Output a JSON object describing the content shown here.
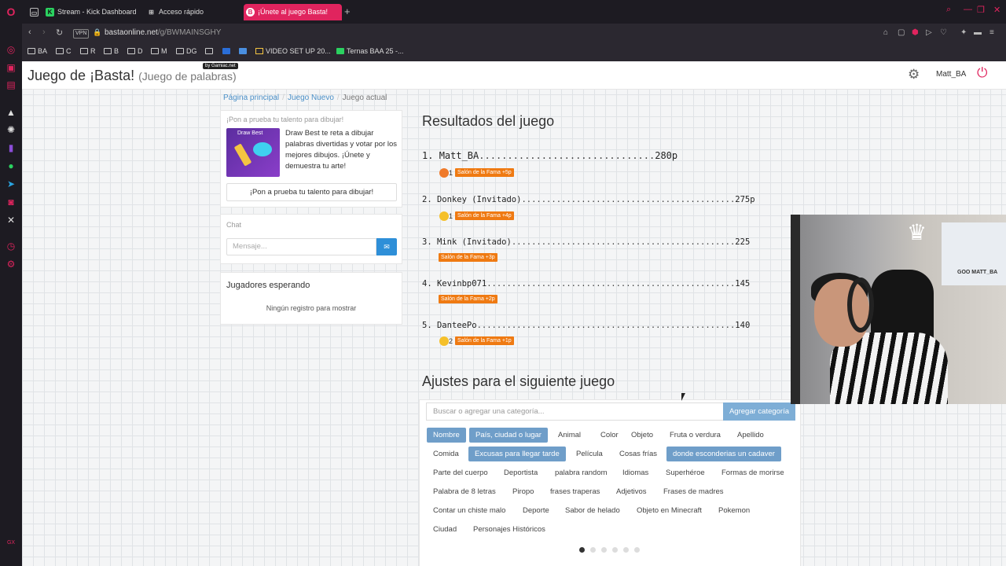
{
  "browser": {
    "tabs": [
      {
        "label": "Stream - Kick Dashboard",
        "favicon": "K"
      },
      {
        "label": "Acceso rápido",
        "favicon": "grid"
      },
      {
        "label": "¡Únete al juego Basta!",
        "favicon": "B"
      }
    ],
    "new_tab": "+",
    "vpn_label": "VPN",
    "url_host": "bastaonline.net",
    "url_path": "/g/BWMAINSGHY",
    "bookmarks": [
      "BA",
      "C",
      "R",
      "B",
      "D",
      "M",
      "DG",
      "VIDEO SET UP 20...",
      "Ternas BAA 25 -..."
    ],
    "accent": "#e0245e"
  },
  "header": {
    "title": "Juego de ¡Basta!",
    "subtitle": "(Juego de palabras)",
    "gamiac": "by Gamiac.net",
    "username": "Matt_BA"
  },
  "breadcrumb": {
    "home": "Página principal",
    "new_game": "Juego Nuevo",
    "current": "Juego actual"
  },
  "promo": {
    "title": "¡Pon a prueba tu talento para dibujar!",
    "image_label": "Draw Best",
    "text": "Draw Best te reta a dibujar palabras divertidas y votar por los mejores dibujos. ¡Únete y demuestra tu arte!",
    "button": "¡Pon a prueba tu talento para dibujar!"
  },
  "chat": {
    "title": "Chat",
    "placeholder": "Mensaje..."
  },
  "waiting": {
    "title": "Jugadores esperando",
    "empty": "Ningún registro para mostrar"
  },
  "results": {
    "title": "Resultados del juego",
    "rows": [
      {
        "rank": "1.",
        "name": "Matt_BA",
        "dots": "...............................",
        "score": "280p",
        "emoji": "angry",
        "emoji_count": "1",
        "fame": "Salón de la Fama +5p"
      },
      {
        "rank": "2.",
        "name": "Donkey (Invitado)",
        "dots": "...........................................",
        "score": "275p",
        "emoji": "surprised",
        "emoji_count": "1",
        "fame": "Salón de la Fama +4p"
      },
      {
        "rank": "3.",
        "name": "Mink (Invitado)",
        "dots": ".............................................",
        "score": "225",
        "emoji": "",
        "emoji_count": "",
        "fame": "Salón de la Fama +3p"
      },
      {
        "rank": "4.",
        "name": "Kevinbp071",
        "dots": "..................................................",
        "score": "145",
        "emoji": "",
        "emoji_count": "",
        "fame": "Salón de la Fama +2p"
      },
      {
        "rank": "5.",
        "name": "DanteePo",
        "dots": "....................................................",
        "score": "140",
        "emoji": "laugh",
        "emoji_count": "2",
        "fame": "Salón de la Fama +1p"
      }
    ]
  },
  "settings": {
    "title": "Ajustes para el siguiente juego",
    "search_placeholder": "Buscar o agregar una categoría...",
    "add_button": "Agregar categoría",
    "chips": [
      {
        "label": "Nombre",
        "selected": true
      },
      {
        "label": "País, ciudad o lugar",
        "selected": true
      },
      {
        "label": "Animal",
        "selected": false
      },
      {
        "label": "Color",
        "selected": false
      },
      {
        "label": "Objeto",
        "selected": false
      },
      {
        "label": "Fruta o verdura",
        "selected": false
      },
      {
        "label": "Apellido",
        "selected": false
      },
      {
        "label": "Comida",
        "selected": false
      },
      {
        "label": "Excusas para llegar tarde",
        "selected": true
      },
      {
        "label": "Película",
        "selected": false
      },
      {
        "label": "Cosas frías",
        "selected": false
      },
      {
        "label": "donde esconderias un cadaver",
        "selected": true
      },
      {
        "label": "Parte del cuerpo",
        "selected": false
      },
      {
        "label": "Deportista",
        "selected": false
      },
      {
        "label": "palabra random",
        "selected": false
      },
      {
        "label": "Idiomas",
        "selected": false
      },
      {
        "label": "Superhéroe",
        "selected": false
      },
      {
        "label": "Formas de morirse",
        "selected": false
      },
      {
        "label": "Palabra de 8 letras",
        "selected": false
      },
      {
        "label": "Piropo",
        "selected": false
      },
      {
        "label": "frases traperas",
        "selected": false
      },
      {
        "label": "Adjetivos",
        "selected": false
      },
      {
        "label": "Frases de madres",
        "selected": false
      },
      {
        "label": "Contar un chiste malo",
        "selected": false
      },
      {
        "label": "Deporte",
        "selected": false
      },
      {
        "label": "Sabor de helado",
        "selected": false
      },
      {
        "label": "Objeto en Minecraft",
        "selected": false
      },
      {
        "label": "Pokemon",
        "selected": false
      },
      {
        "label": "Ciudad",
        "selected": false
      },
      {
        "label": "Personajes Históricos",
        "selected": false
      }
    ],
    "pager_pages": 6,
    "pager_active": 1
  },
  "webcam": {
    "poster_text": "GOO MATT_BA"
  }
}
